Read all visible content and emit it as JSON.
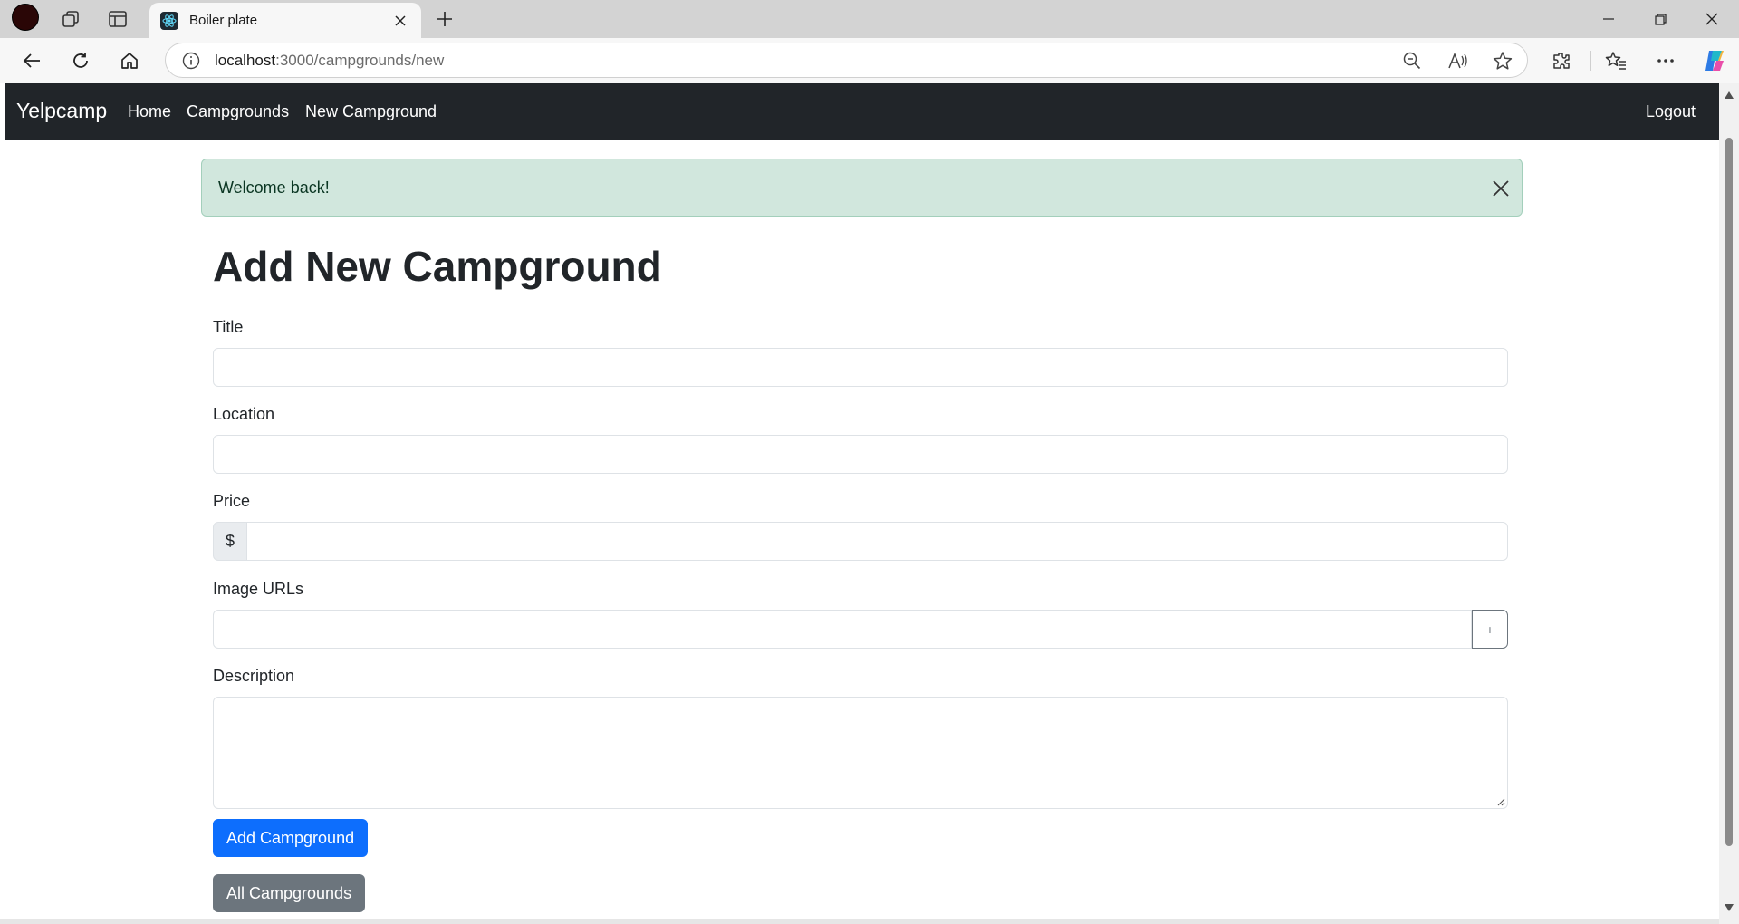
{
  "browser": {
    "tab": {
      "title": "Boiler plate",
      "favicon": "react-icon"
    },
    "address": {
      "host": "localhost",
      "path": ":3000/campgrounds/new"
    }
  },
  "navbar": {
    "brand": "Yelpcamp",
    "links": [
      "Home",
      "Campgrounds",
      "New Campground"
    ],
    "logout": "Logout"
  },
  "alert": {
    "message": "Welcome back!",
    "type": "success"
  },
  "form": {
    "heading": "Add New Campground",
    "title_label": "Title",
    "title_value": "",
    "location_label": "Location",
    "location_value": "",
    "price_label": "Price",
    "price_prefix": "$",
    "price_value": "",
    "image_label": "Image URLs",
    "image_value": "",
    "add_image_label": "+",
    "description_label": "Description",
    "description_value": "",
    "submit_label": "Add Campground",
    "all_label": "All Campgrounds"
  },
  "colors": {
    "navbar": "#212529",
    "alert_bg": "#d1e7dd",
    "primary": "#0d6efd",
    "secondary": "#6c757d"
  }
}
